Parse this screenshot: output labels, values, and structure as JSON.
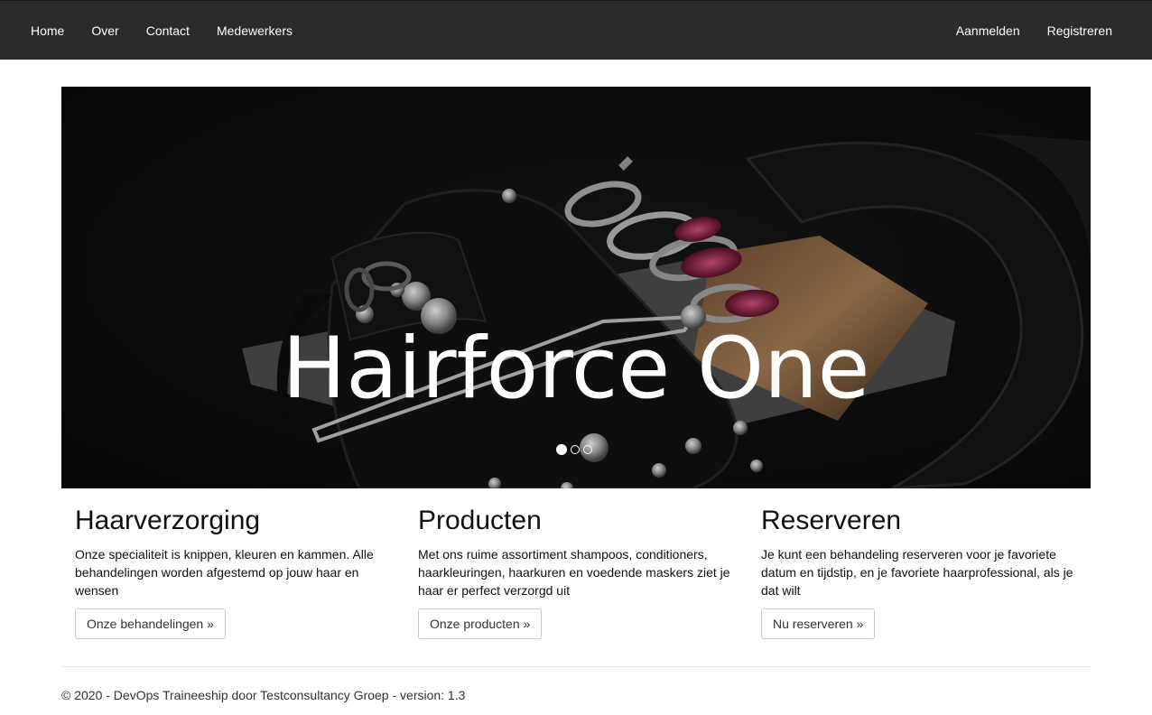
{
  "navbar": {
    "left_links": [
      "Home",
      "Over",
      "Contact",
      "Medewerkers"
    ],
    "right_links": [
      "Aanmelden",
      "Registreren"
    ]
  },
  "hero": {
    "title": "Hairforce One",
    "slide_count": 3,
    "active_slide": 1,
    "image_icon": "scissors-holster-photo"
  },
  "features": [
    {
      "heading": "Haarverzorging",
      "text": "Onze specialiteit is knippen, kleuren en kammen. Alle behandelingen worden afgestemd op jouw haar en wensen",
      "button": "Onze behandelingen »"
    },
    {
      "heading": "Producten",
      "text": "Met ons ruime assortiment shampoos, conditioners, haarkleuringen, haarkuren en voedende maskers ziet je haar er perfect verzorgd uit",
      "button": "Onze producten »"
    },
    {
      "heading": "Reserveren",
      "text": "Je kunt een behandeling reserveren voor je favoriete datum en tijdstip, en je favoriete haarprofessional, als je dat wilt",
      "button": "Nu reserveren »"
    }
  ],
  "footer": {
    "text": "© 2020 - DevOps Traineeship door Testconsultancy Groep - version: 1.3"
  },
  "colors": {
    "navbar_bg": "#2b2b2b",
    "hero_bg": "#0b0b0b"
  }
}
